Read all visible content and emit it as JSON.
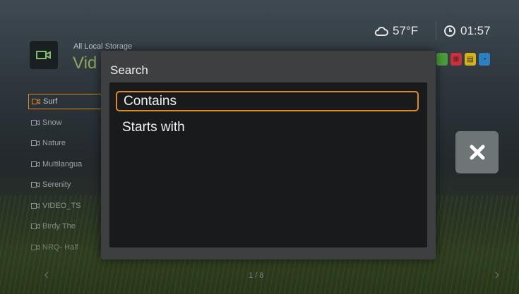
{
  "status": {
    "temperature": "57°F",
    "time": "01:57"
  },
  "header": {
    "source": "All Local Storage",
    "category": "Vid"
  },
  "colors": {
    "accent": "#e08a25",
    "green": "#4a9d3a",
    "red": "#c8303a",
    "yellow": "#d4b218",
    "blue": "#2c7fc0"
  },
  "file_list": [
    {
      "label": "Surf",
      "selected": true
    },
    {
      "label": "Snow"
    },
    {
      "label": "Nature"
    },
    {
      "label": "Multilangua"
    },
    {
      "label": "Serenity"
    },
    {
      "label": "VIDEO_TS"
    },
    {
      "label": "Birdy The"
    },
    {
      "label": "NRQ- Half"
    }
  ],
  "pagination": {
    "indicator": "1 / 8"
  },
  "dialog": {
    "title": "Search",
    "options": [
      "Contains",
      "Starts with"
    ],
    "focused_index": 0
  },
  "icons": {
    "weather": "cloud-icon",
    "clock": "clock-icon",
    "close": "close-x-icon",
    "video": "video-camera-icon"
  }
}
